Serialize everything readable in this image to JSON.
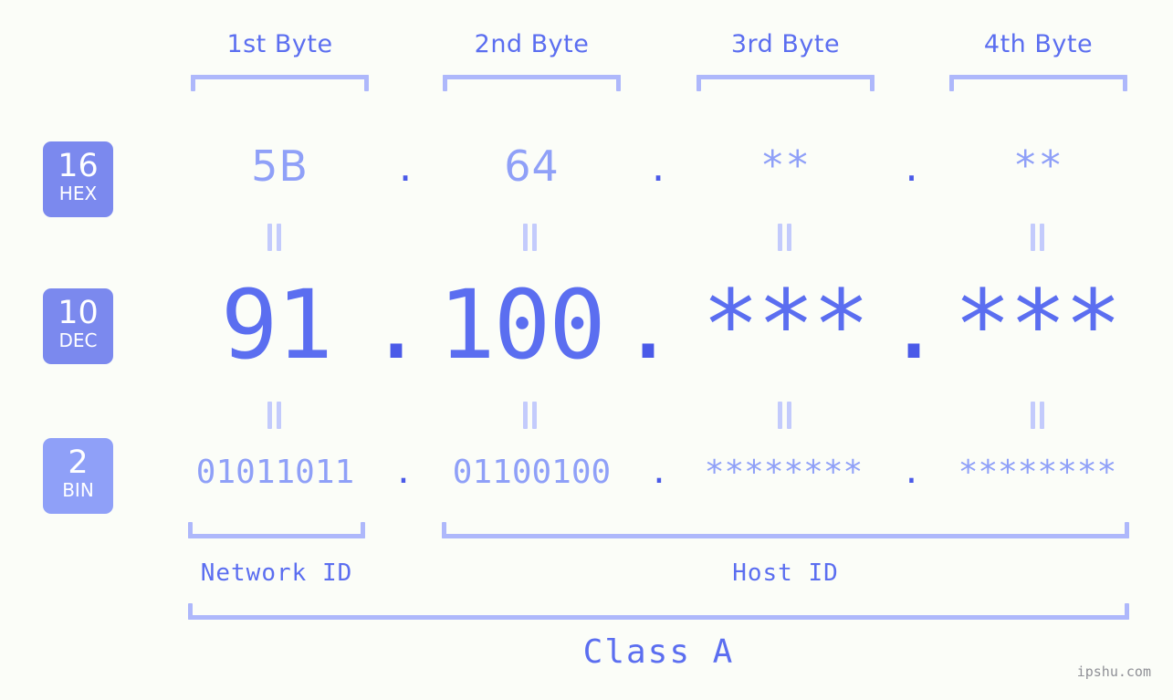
{
  "site": {
    "watermark": "ipshu.com"
  },
  "colors": {
    "background": "#fbfdf8",
    "accent_strong": "#4a5ae8",
    "accent": "#5b6ef0",
    "accent_light": "#8fa0f8",
    "accent_pale": "#aeb8fb",
    "separator": "#c3cbfc",
    "badge_hex": "#7b89ee",
    "badge_dec": "#7b89ee",
    "badge_bin": "#8fa0f8",
    "watermark": "#8f9096"
  },
  "byte_headers": [
    {
      "label": "1st Byte"
    },
    {
      "label": "2nd Byte"
    },
    {
      "label": "3rd Byte"
    },
    {
      "label": "4th Byte"
    }
  ],
  "radix_badges": [
    {
      "number": "16",
      "label": "HEX"
    },
    {
      "number": "10",
      "label": "DEC"
    },
    {
      "number": "2",
      "label": "BIN"
    }
  ],
  "rows": {
    "hex": {
      "radix_number": "16",
      "radix_label": "HEX",
      "values": [
        "5B",
        "64",
        "**",
        "**"
      ],
      "separators": [
        ".",
        ".",
        "."
      ]
    },
    "dec": {
      "radix_number": "10",
      "radix_label": "DEC",
      "values": [
        "91",
        "100",
        "***",
        "***"
      ],
      "separators": [
        ".",
        ".",
        "."
      ]
    },
    "bin": {
      "radix_number": "2",
      "radix_label": "BIN",
      "values": [
        "01011011",
        "01100100",
        "********",
        "********"
      ],
      "separators": [
        ".",
        ".",
        "."
      ]
    }
  },
  "equality_marks": {
    "glyph": "||",
    "count_per_gap": 4,
    "gaps": [
      "hex-to-dec",
      "dec-to-bin"
    ]
  },
  "segments": [
    {
      "name": "network-id",
      "label": "Network ID"
    },
    {
      "name": "host-id",
      "label": "Host ID"
    }
  ],
  "class": {
    "label": "Class A"
  }
}
